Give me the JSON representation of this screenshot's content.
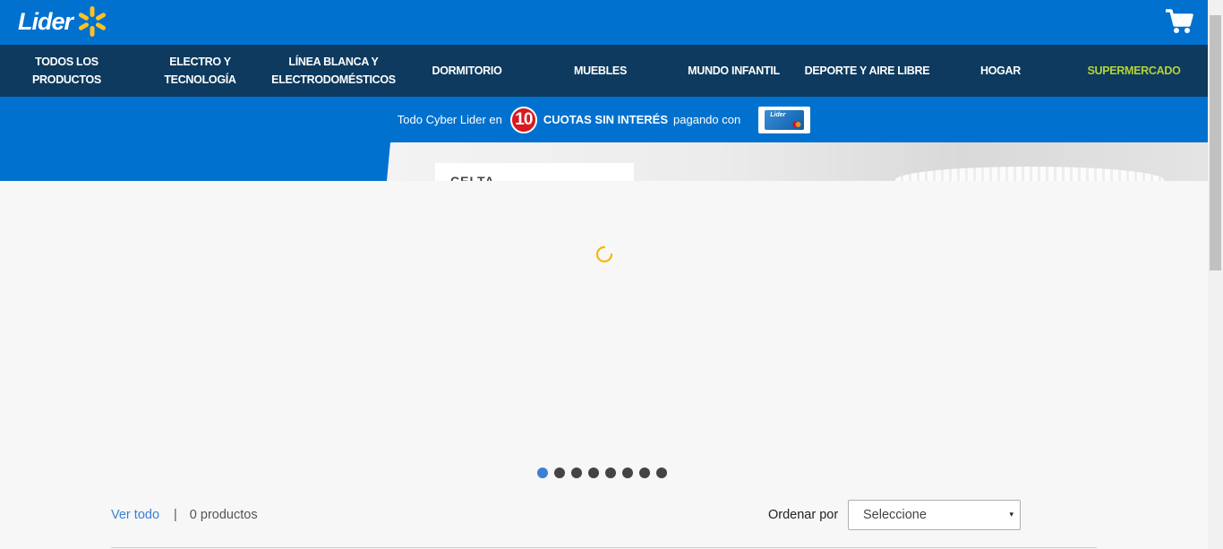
{
  "header": {
    "logo_text": "Lider",
    "cart_icon": "shopping-cart-icon",
    "brand_color": "#0071ce"
  },
  "nav": {
    "items": [
      {
        "label": "TODOS LOS PRODUCTOS",
        "lines": [
          "TODOS LOS",
          "PRODUCTOS"
        ]
      },
      {
        "label": "ELECTRO Y TECNOLOGÍA",
        "lines": [
          "ELECTRO Y",
          "TECNOLOGÍA"
        ]
      },
      {
        "label": "LÍNEA BLANCA Y ELECTRODOMÉSTICOS",
        "lines": [
          "LÍNEA BLANCA Y",
          "ELECTRODOMÉSTICOS"
        ]
      },
      {
        "label": "DORMITORIO",
        "lines": [
          "DORMITORIO"
        ]
      },
      {
        "label": "MUEBLES",
        "lines": [
          "MUEBLES"
        ]
      },
      {
        "label": "MUNDO INFANTIL",
        "lines": [
          "MUNDO INFANTIL"
        ]
      },
      {
        "label": "DEPORTE Y AIRE LIBRE",
        "lines": [
          "DEPORTE Y AIRE LIBRE"
        ]
      },
      {
        "label": "HOGAR",
        "lines": [
          "HOGAR"
        ]
      },
      {
        "label": "SUPERMERCADO",
        "lines": [
          "SUPERMERCADO"
        ]
      }
    ],
    "background": "#0d3a5e",
    "accent_color": "#b5d334"
  },
  "promo": {
    "prefix": "Todo Cyber Lider en",
    "number": "10",
    "highlight": "CUOTAS SIN INTERÉS",
    "suffix": "pagando con",
    "card_label": "Lider",
    "card_icon": "lider-credit-card-icon"
  },
  "banner": {
    "box_text": "CELTA"
  },
  "carousel": {
    "slide_count": 8,
    "active_index": 0,
    "spinner_icon": "loading-spinner-icon",
    "spinner_color": "#f5b800",
    "active_dot_color": "#3a7fd5"
  },
  "toolbar": {
    "view_all": "Ver todo",
    "separator": "|",
    "product_count": "0 productos",
    "sort_label": "Ordenar por",
    "sort_value": "Seleccione",
    "sort_caret": "▾"
  }
}
